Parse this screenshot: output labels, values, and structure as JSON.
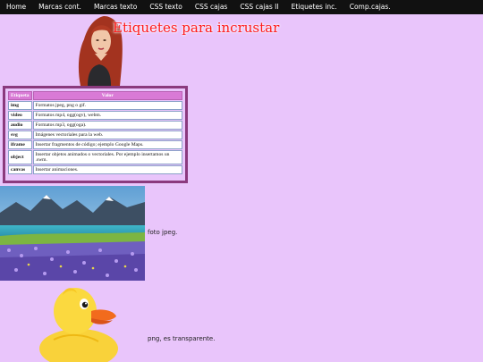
{
  "nav": {
    "items": [
      "Home",
      "Marcas cont.",
      "Marcas texto",
      "CSS texto",
      "CSS cajas",
      "CSS cajas II",
      "Etiquetes inc.",
      "Comp.cajas."
    ]
  },
  "hero": {
    "title": "Etiquetes para incrustar"
  },
  "table": {
    "headers": [
      "Etiqueta",
      "Valor"
    ],
    "rows": [
      [
        "img",
        "Formatos jpeg, png o gif."
      ],
      [
        "video",
        "Formatos mp4, ogg(ogv), webm."
      ],
      [
        "audio",
        "Formatos mp3, ogg(oga)."
      ],
      [
        "svg",
        "Imágenes vectoriales para la web."
      ],
      [
        "iframe",
        "Insertar fragmentos de código; ejemplo Google Maps."
      ],
      [
        "object",
        "Insertar objetos animados o vectoriales. Por ejemplo insertamos un .swm."
      ],
      [
        "canvas",
        "Insertar animaciones."
      ]
    ]
  },
  "photo": {
    "caption": "foto jpeg."
  },
  "duck": {
    "caption": "png, es transparente."
  }
}
